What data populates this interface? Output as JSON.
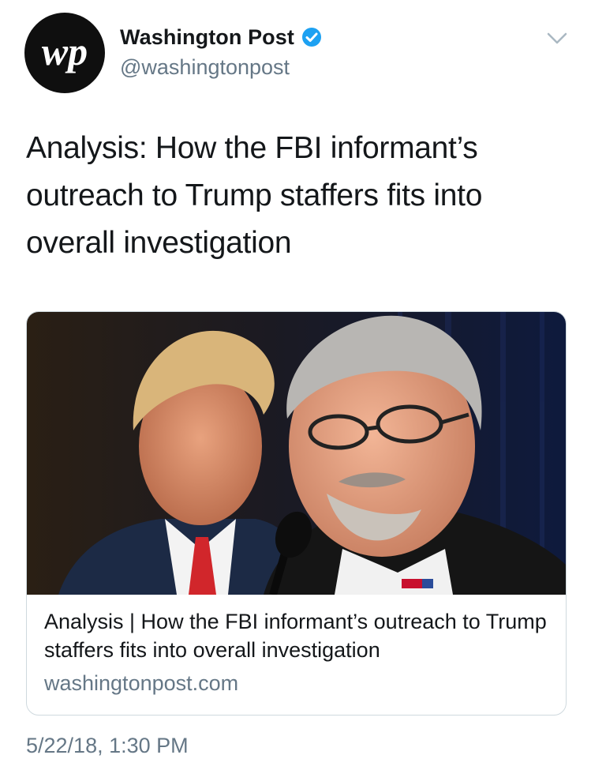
{
  "account": {
    "logo_text": "wp",
    "name": "Washington Post",
    "handle": "@washingtonpost",
    "verified": true
  },
  "icons": {
    "verified": "verified-badge-icon",
    "menu": "chevron-down-icon"
  },
  "tweet": {
    "text": "Analysis: How the FBI informant’s outreach to Trump staffers fits into overall investigation",
    "timestamp": "5/22/18, 1:30 PM"
  },
  "card": {
    "title": "Analysis | How the FBI informant’s outreach to Trump staffers fits into overall investigation",
    "domain": "washingtonpost.com",
    "image": "news-photo"
  },
  "colors": {
    "text": "#14171a",
    "secondary": "#657786",
    "verified": "#1da1f2",
    "border": "#cfd9de"
  }
}
